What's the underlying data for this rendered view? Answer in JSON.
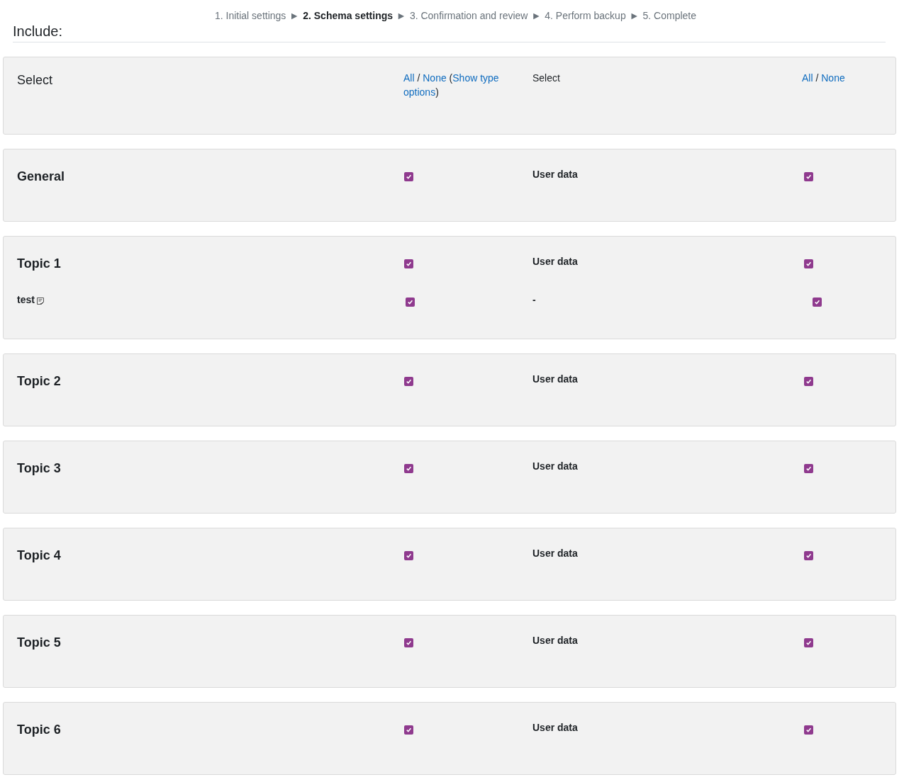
{
  "steps": [
    {
      "label": "1. Initial settings",
      "selected": false
    },
    {
      "label": "►",
      "selected": false
    },
    {
      "label": "2. Schema settings",
      "selected": true
    },
    {
      "label": "►",
      "selected": false
    },
    {
      "label": "3. Confirmation and review",
      "selected": false
    },
    {
      "label": "►",
      "selected": false
    },
    {
      "label": "4. Perform backup",
      "selected": false
    },
    {
      "label": "►",
      "selected": false
    },
    {
      "label": "5. Complete",
      "selected": false
    }
  ],
  "include_heading": "Include:",
  "select_row": {
    "label": "Select",
    "include_lines": [
      [
        {
          "kind": "link",
          "text": "All"
        },
        {
          "kind": "plain",
          "text": " / "
        },
        {
          "kind": "link",
          "text": "None"
        },
        {
          "kind": "plain",
          "text": " ("
        },
        {
          "kind": "link",
          "text": "Show type"
        }
      ],
      [
        {
          "kind": "link",
          "text": "options"
        },
        {
          "kind": "plain",
          "text": ")"
        }
      ]
    ],
    "userdata_label": "Select",
    "userdata_parts": [
      {
        "kind": "link",
        "text": "All"
      },
      {
        "kind": "plain",
        "text": " / "
      },
      {
        "kind": "link",
        "text": "None"
      }
    ]
  },
  "sections": [
    {
      "title": "General",
      "checked": true,
      "userdata_label": "User data",
      "userdata_checked": true
    },
    {
      "title": "Topic 1",
      "checked": true,
      "userdata_label": "User data",
      "userdata_checked": true,
      "items": [
        {
          "name": "test",
          "checked": true,
          "userdata_label": "-",
          "userdata_checked": true
        }
      ]
    },
    {
      "title": "Topic 2",
      "checked": true,
      "userdata_label": "User data",
      "userdata_checked": true
    },
    {
      "title": "Topic 3",
      "checked": true,
      "userdata_label": "User data",
      "userdata_checked": true
    },
    {
      "title": "Topic 4",
      "checked": true,
      "userdata_label": "User data",
      "userdata_checked": true
    },
    {
      "title": "Topic 5",
      "checked": true,
      "userdata_label": "User data",
      "userdata_checked": true
    },
    {
      "title": "Topic 6",
      "checked": true,
      "userdata_label": "User data",
      "userdata_checked": true
    }
  ]
}
